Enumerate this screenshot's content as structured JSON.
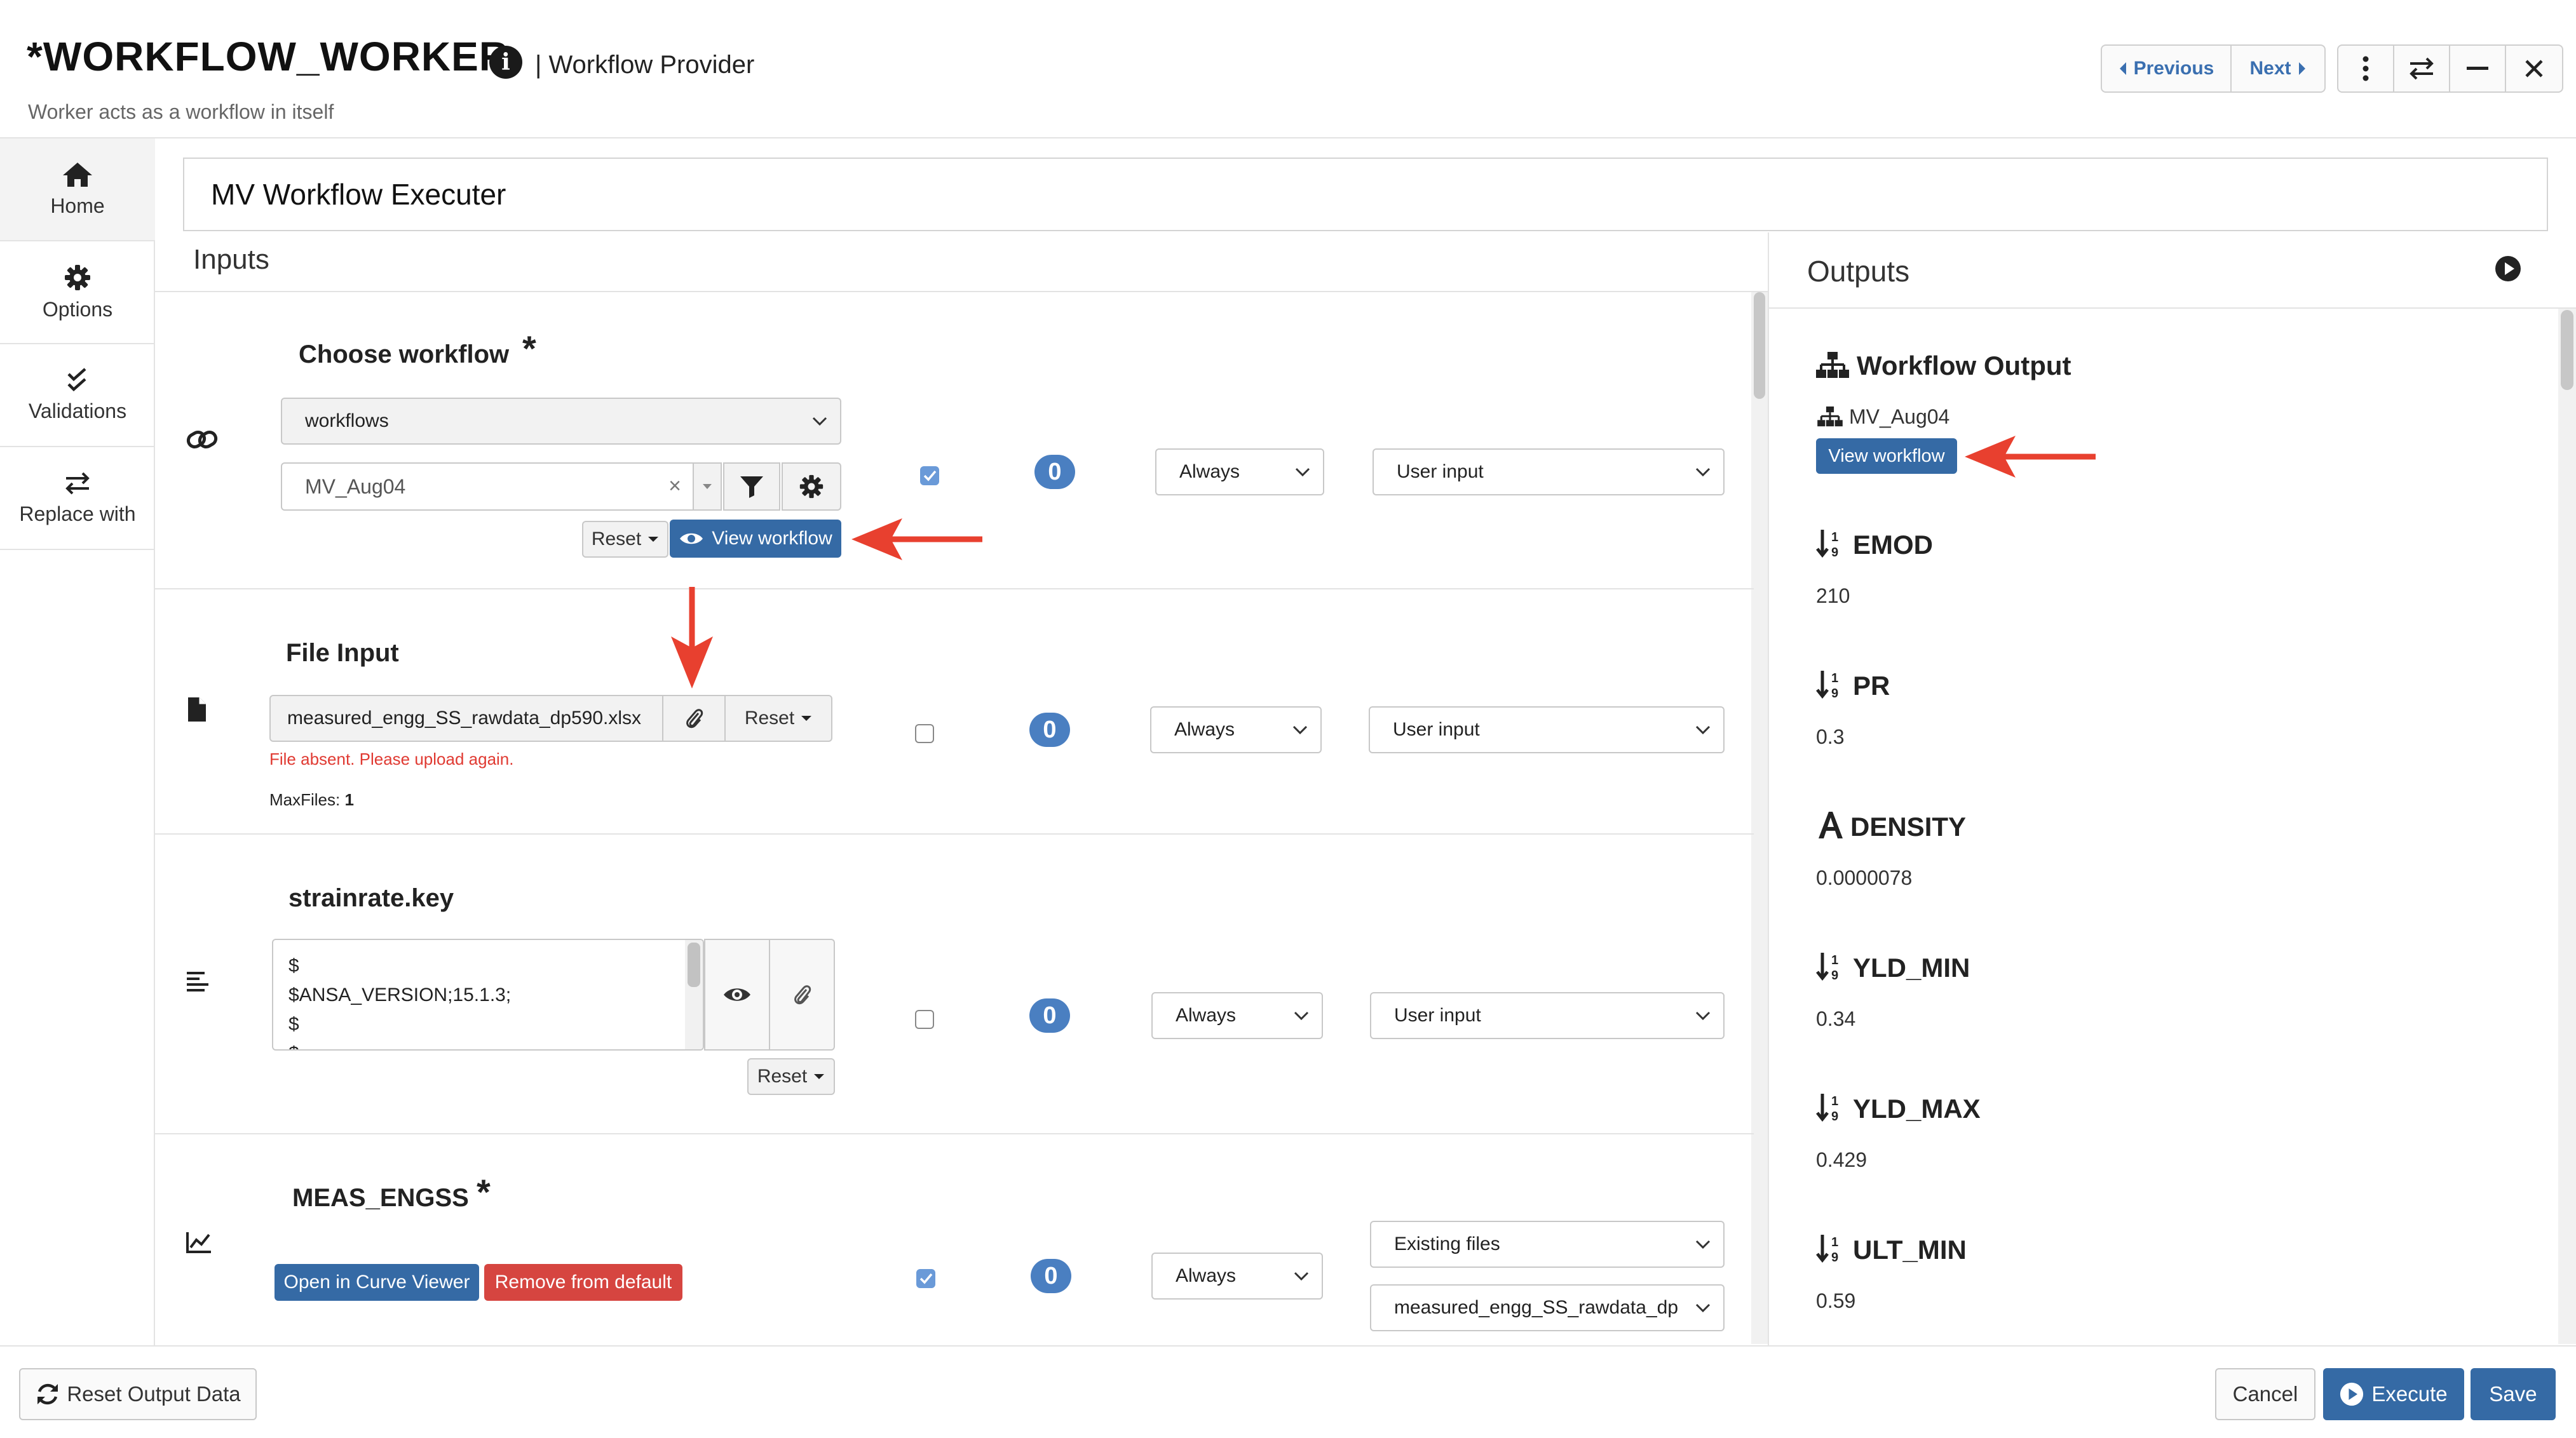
{
  "header": {
    "title": "*WORKFLOW_WORKER",
    "info_glyph": "i",
    "provider": "| Workflow Provider",
    "subtitle": "Worker acts as a workflow in itself",
    "previous_label": "Previous",
    "next_label": "Next"
  },
  "sidebar": {
    "items": [
      {
        "label": "Home",
        "icon": "home-icon"
      },
      {
        "label": "Options",
        "icon": "gear-icon"
      },
      {
        "label": "Validations",
        "icon": "double-check-icon"
      },
      {
        "label": "Replace with",
        "icon": "swap-icon"
      }
    ]
  },
  "main": {
    "workflow_name": "MV Workflow Executer",
    "inputs_title": "Inputs"
  },
  "inputs": {
    "choose_workflow": {
      "label": "Choose workflow",
      "required_mark": "*",
      "category_value": "workflows",
      "selected_value": "MV_Aug04",
      "clear_glyph": "×",
      "reset_label": "Reset",
      "view_label": "View workflow",
      "count": "0",
      "checked": true,
      "frequency": "Always",
      "source": "User input"
    },
    "file_input": {
      "label": "File Input",
      "value": "measured_engg_SS_rawdata_dp590.xlsx",
      "reset_label": "Reset",
      "error": "File absent. Please upload again.",
      "max_files_label": "MaxFiles:",
      "max_files_value": "1",
      "count": "0",
      "checked": false,
      "frequency": "Always",
      "source": "User input"
    },
    "strainrate": {
      "label": "strainrate.key",
      "lines": [
        "$",
        "$ANSA_VERSION;15.1.3;",
        "$",
        "$"
      ],
      "reset_label": "Reset",
      "count": "0",
      "checked": false,
      "frequency": "Always",
      "source": "User input"
    },
    "meas_engss": {
      "label": "MEAS_ENGSS",
      "required_mark": "*",
      "curve_viewer_label": "Open in Curve Viewer",
      "remove_label": "Remove from default",
      "count": "0",
      "checked": true,
      "frequency": "Always",
      "source": "Existing files",
      "file_value": "measured_engg_SS_rawdata_dp"
    }
  },
  "outputs": {
    "title": "Outputs",
    "workflow_output_label": "Workflow Output",
    "workflow_name": "MV_Aug04",
    "view_workflow_label": "View workflow",
    "items": [
      {
        "name": "EMOD",
        "value": "210",
        "icon": "sort-numeric-icon"
      },
      {
        "name": "PR",
        "value": "0.3",
        "icon": "sort-numeric-icon"
      },
      {
        "name": "DENSITY",
        "value": "0.0000078",
        "icon": "text-type-icon"
      },
      {
        "name": "YLD_MIN",
        "value": "0.34",
        "icon": "sort-numeric-icon"
      },
      {
        "name": "YLD_MAX",
        "value": "0.429",
        "icon": "sort-numeric-icon"
      },
      {
        "name": "ULT_MIN",
        "value": "0.59",
        "icon": "sort-numeric-icon"
      }
    ]
  },
  "footer": {
    "reset_output_label": "Reset Output Data",
    "cancel_label": "Cancel",
    "execute_label": "Execute",
    "save_label": "Save"
  },
  "colors": {
    "primary": "#356aa5",
    "danger": "#d64540",
    "badge": "#4a7fc1",
    "annotation_arrow": "#e8402f",
    "error_text": "#e03a32"
  }
}
